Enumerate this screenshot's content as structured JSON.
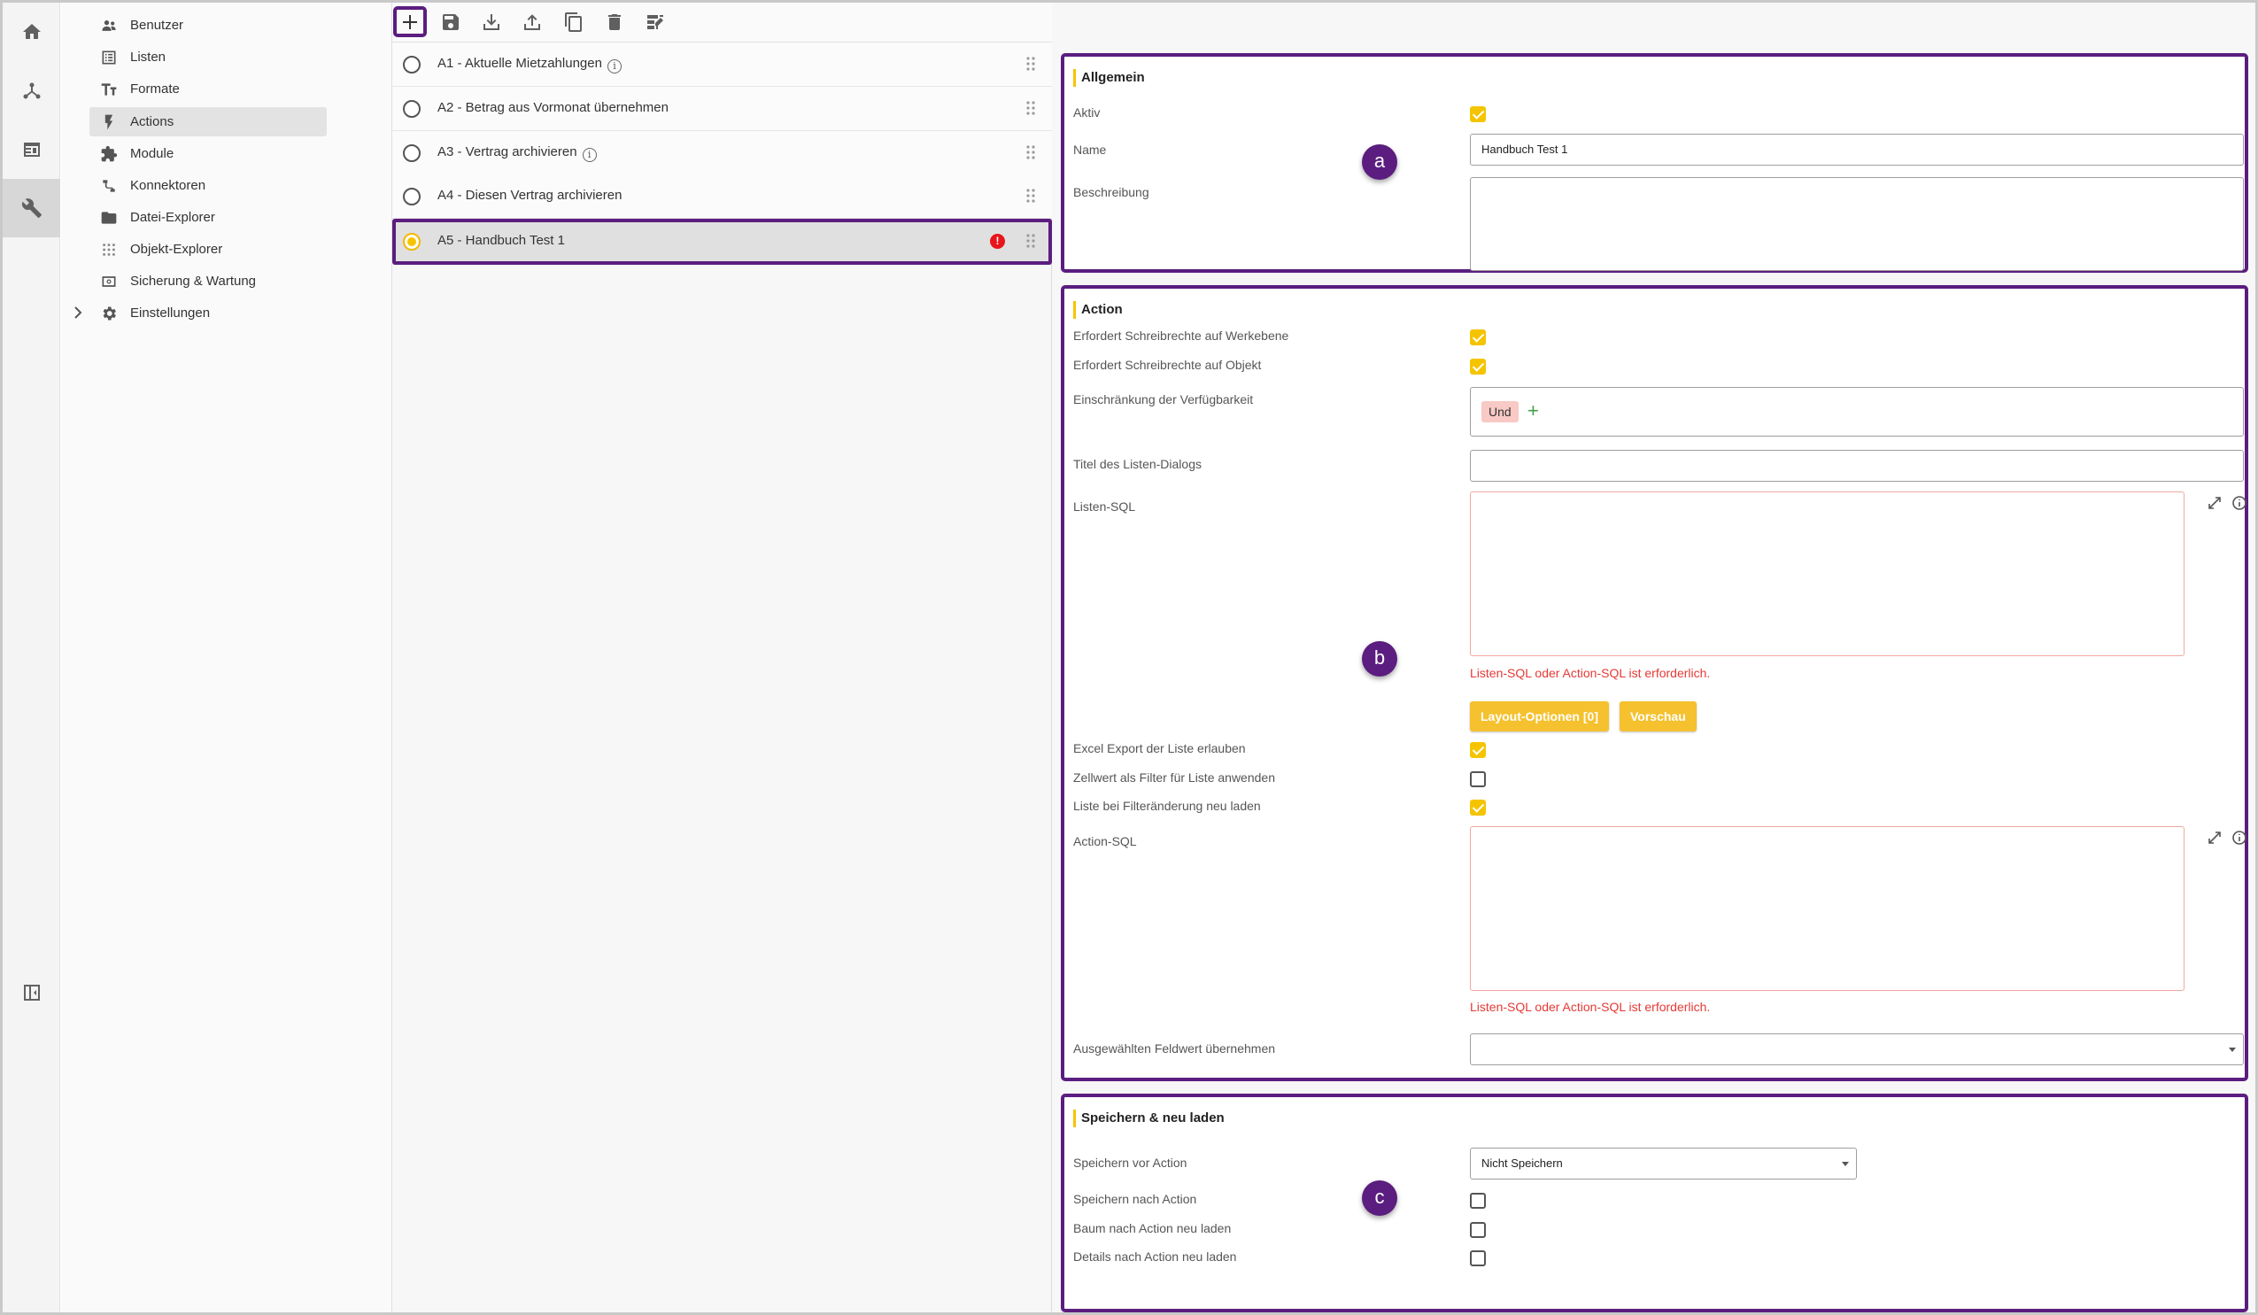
{
  "nav": {
    "items": [
      {
        "label": "Benutzer",
        "icon": "users-icon"
      },
      {
        "label": "Listen",
        "icon": "list-icon"
      },
      {
        "label": "Formate",
        "icon": "text-format-icon"
      },
      {
        "label": "Actions",
        "icon": "lightning-icon"
      },
      {
        "label": "Module",
        "icon": "puzzle-icon"
      },
      {
        "label": "Konnektoren",
        "icon": "connector-icon"
      },
      {
        "label": "Datei-Explorer",
        "icon": "folder-icon"
      },
      {
        "label": "Objekt-Explorer",
        "icon": "object-grid-icon"
      },
      {
        "label": "Sicherung & Wartung",
        "icon": "backup-icon"
      },
      {
        "label": "Einstellungen",
        "icon": "gear-icon"
      }
    ],
    "selected": "Actions"
  },
  "actions_list": {
    "items": [
      {
        "label": "A1 - Aktuelle Mietzahlungen",
        "info": "i"
      },
      {
        "label": "A2 - Betrag aus Vormonat übernehmen"
      },
      {
        "label": "A3 - Vertrag archivieren",
        "info": "i"
      },
      {
        "label": "A4 - Diesen Vertrag archivieren"
      },
      {
        "label": "A5 - Handbuch Test 1",
        "error": "!"
      }
    ]
  },
  "allgemein": {
    "title": "Allgemein",
    "aktiv_label": "Aktiv",
    "aktiv_checked": true,
    "name_label": "Name",
    "name_value": "Handbuch Test 1",
    "beschreibung_label": "Beschreibung",
    "marker": "a"
  },
  "action": {
    "title": "Action",
    "fields": {
      "schreib_werkebene": "Erfordert Schreibrechte auf Werkebene",
      "schreib_objekt": "Erfordert Schreibrechte auf Objekt",
      "einschraenkung": "Einschränkung der Verfügbarkeit",
      "einschraenkung_chip": "Und",
      "einschraenkung_add": "+",
      "titel_dialog": "Titel des Listen-Dialogs",
      "listen_sql": "Listen-SQL",
      "listen_sql_error": "Listen-SQL oder Action-SQL ist erforderlich.",
      "layout_button": "Layout-Optionen [0]",
      "vorschau_button": "Vorschau",
      "excel_export": "Excel Export der Liste erlauben",
      "zellwert_filter": "Zellwert als Filter für Liste anwenden",
      "liste_neu_laden": "Liste bei Filteränderung neu laden",
      "action_sql": "Action-SQL",
      "action_sql_error": "Listen-SQL oder Action-SQL ist erforderlich.",
      "feldwert": "Ausgewählten Feldwert übernehmen"
    },
    "checks": {
      "schreib_werkebene": true,
      "schreib_objekt": true,
      "excel_export": true,
      "zellwert_filter": false,
      "liste_neu_laden": true
    },
    "marker": "b"
  },
  "speichern": {
    "title": "Speichern & neu laden",
    "vor_action_label": "Speichern vor Action",
    "vor_action_value": "Nicht Speichern",
    "nach_action_label": "Speichern nach Action",
    "baum_label": "Baum nach Action neu laden",
    "details_label": "Details nach Action neu laden",
    "checks": {
      "nach_action": false,
      "baum": false,
      "details": false
    },
    "marker": "c"
  },
  "colors": {
    "accent": "#f5c400",
    "highlight_border": "#5b1d7f",
    "error": "#e53935",
    "error_dot": "#e8151b"
  }
}
